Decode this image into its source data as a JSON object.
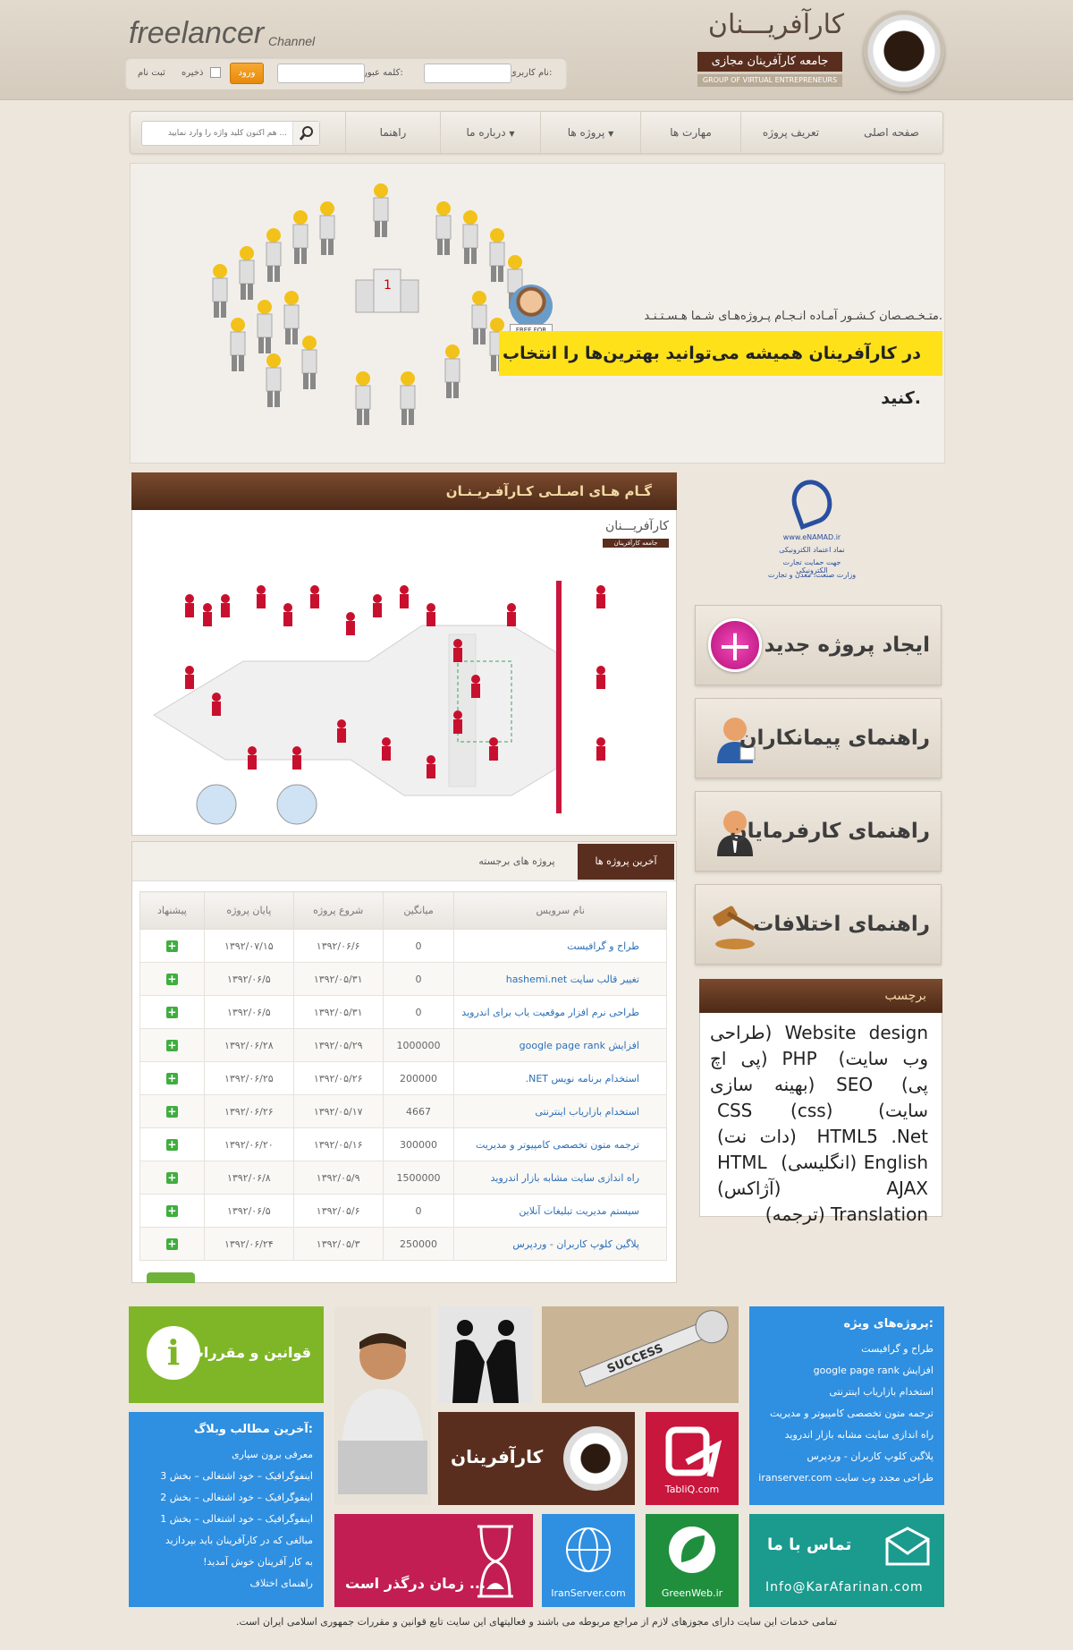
{
  "header": {
    "brand_title": "کارآفریـــنان",
    "brand_sub": "جامعه کارآفرینان مجازی",
    "brand_en": "GROUP OF VIRTUAL ENTREPRENEURS",
    "channel_word": "freelancer",
    "channel_suffix": "Channel",
    "username_label": "نام کاربری:",
    "password_label": "کلمه عبور:",
    "login_label": "ورود",
    "remember_label": "ذخیره",
    "register_label": "ثبت نام"
  },
  "nav": {
    "items": [
      "صفحه اصلی",
      "تعریف پروژه",
      "مهارت ها",
      "پروژه ها",
      "درباره ما",
      "راهنما"
    ],
    "search_placeholder": "هم اکنون کلید واژه را وارد نمایید ..."
  },
  "banner": {
    "tagline": "متـخـصـصان کـشـور آمـاده انـجـام پـروژه‌هـای شـما هـسـتـنـد.",
    "headline": "در کارآفرینان همیشه می‌توانید بهترین‌ها را انتخاب کنید.",
    "badge": "FREE FOR JOB"
  },
  "steps": {
    "title": "گـام هـای اصـلـی کـارآفـریـنـان",
    "logo": "کارآفریـــنان",
    "logo_sub": "جامعه کارآفرینان"
  },
  "projects": {
    "tabs": [
      "آخرین پروژه ها",
      "پروژه های برجسته"
    ],
    "columns": [
      "نام سرویس",
      "میانگین",
      "شروع پروژه",
      "پایان پروژه",
      "پیشنهاد"
    ],
    "rows": [
      {
        "name": "طراح و گرافیست",
        "avg": "0",
        "start": "۱۳۹۲/۰۶/۶",
        "end": "۱۳۹۲/۰۷/۱۵"
      },
      {
        "name": "تغییر قالب سایت hashemi.net",
        "avg": "0",
        "start": "۱۳۹۲/۰۵/۳۱",
        "end": "۱۳۹۲/۰۶/۵"
      },
      {
        "name": "طراحی نرم افزار موقعیت یاب برای اندروید",
        "avg": "0",
        "start": "۱۳۹۲/۰۵/۳۱",
        "end": "۱۳۹۲/۰۶/۵"
      },
      {
        "name": "افزایش google page rank",
        "avg": "1000000",
        "start": "۱۳۹۲/۰۵/۲۹",
        "end": "۱۳۹۲/۰۶/۲۸"
      },
      {
        "name": "استخدام برنامه نویس NET.",
        "avg": "200000",
        "start": "۱۳۹۲/۰۵/۲۶",
        "end": "۱۳۹۲/۰۶/۲۵"
      },
      {
        "name": "استخدام بازاریاب اینترنتی",
        "avg": "4667",
        "start": "۱۳۹۲/۰۵/۱۷",
        "end": "۱۳۹۲/۰۶/۲۶"
      },
      {
        "name": "ترجمه متون تخصصی کامپیوتر و مدیریت",
        "avg": "300000",
        "start": "۱۳۹۲/۰۵/۱۶",
        "end": "۱۳۹۲/۰۶/۲۰"
      },
      {
        "name": "راه اندازی سایت مشابه بازار اندروید",
        "avg": "1500000",
        "start": "۱۳۹۲/۰۵/۹",
        "end": "۱۳۹۲/۰۶/۸"
      },
      {
        "name": "سیستم مدیریت تبلیغات آنلاین",
        "avg": "0",
        "start": "۱۳۹۲/۰۵/۶",
        "end": "۱۳۹۲/۰۶/۵"
      },
      {
        "name": "پلاگین کلوپ کاربران - وردپرس",
        "avg": "250000",
        "start": "۱۳۹۲/۰۵/۳",
        "end": "۱۳۹۲/۰۶/۲۴"
      }
    ],
    "offer_symbol": "+"
  },
  "enamad": {
    "site": "www.eNAMAD.ir",
    "line1": "نماد اعتماد الکترونیکی",
    "line2": "جهت حمایت تجارت الکترونیکی",
    "line3": "وزارت صنعت، معدن و تجارت"
  },
  "side": {
    "new_project": "ایجاد پروژه جدید",
    "contractors_guide": "راهنمای پیمانکاران",
    "employers_guide": "راهنمای کارفرمایان",
    "disputes_guide": "راهنمای اختلافات"
  },
  "tags": {
    "title": "برچسب",
    "items": [
      "Website design (طراحی وب سایت)",
      "PHP (پی اچ پی)",
      "SEO (بهینه سازی سایت)",
      "CSS (css)",
      "HTML5",
      ".Net (دات نت)",
      "English (انگلیسی)",
      "HTML",
      "AJAX (آژاکس)",
      "Translation (ترجمه)"
    ]
  },
  "tiles": {
    "rules": "قوانین و مقررات",
    "rules_symbol": "i",
    "blog_title": "آخرین مطالب وبلاگ:",
    "blog_items": [
      "معرفی برون سپاری",
      "اینفوگرافیک – خود اشتغالی – بخش 3",
      "اینفوگرافیک – خود اشتغالی – بخش 2",
      "اینفوگرافیک – خود اشتغالی – بخش 1",
      "مبالغی که در کارآفرینان باید بپردازید",
      "به کار آفرینان خوش آمدید!",
      "راهنمای اختلاف"
    ],
    "featured_title": "پروژه‌های ویژه:",
    "featured_items": [
      "طراح و گرافیست",
      "افزایش google page rank",
      "استخدام بازاریاب اینترنتی",
      "ترجمه متون تخصصی کامپیوتر و مدیریت",
      "راه اندازی سایت مشابه بازار اندروید",
      "پلاگین کلوپ کاربران - وردپرس",
      "طراحی مجدد وب سایت iranserver.com"
    ],
    "brand": "کارآفرینان",
    "tabliq": "TabliQ.com",
    "time": "زمان درگذر است ...",
    "iranserver": "IranServer.com",
    "greenweb": "GreenWeb.ir",
    "contact": "تماس با ما",
    "email": "Info@KarAfarinan.com",
    "success": "SUCCESS"
  },
  "footer": {
    "text": "تمامی خدمات این سایت دارای مجوزهای لازم از مراجع مربوطه می باشند و فعالیتهای این سایت تابع قوانین و مقررات جمهوری اسلامی ایران است."
  },
  "colors": {
    "brown": "#5a2e1e",
    "accent_orange": "#e88a0b",
    "banner_yellow": "#ffe11a",
    "tile_green": "#7fb627",
    "tile_blue": "#2f8fe0",
    "tile_red": "#c8163c",
    "tile_pink": "#c21e53",
    "tile_teal": "#1b9a8e"
  }
}
